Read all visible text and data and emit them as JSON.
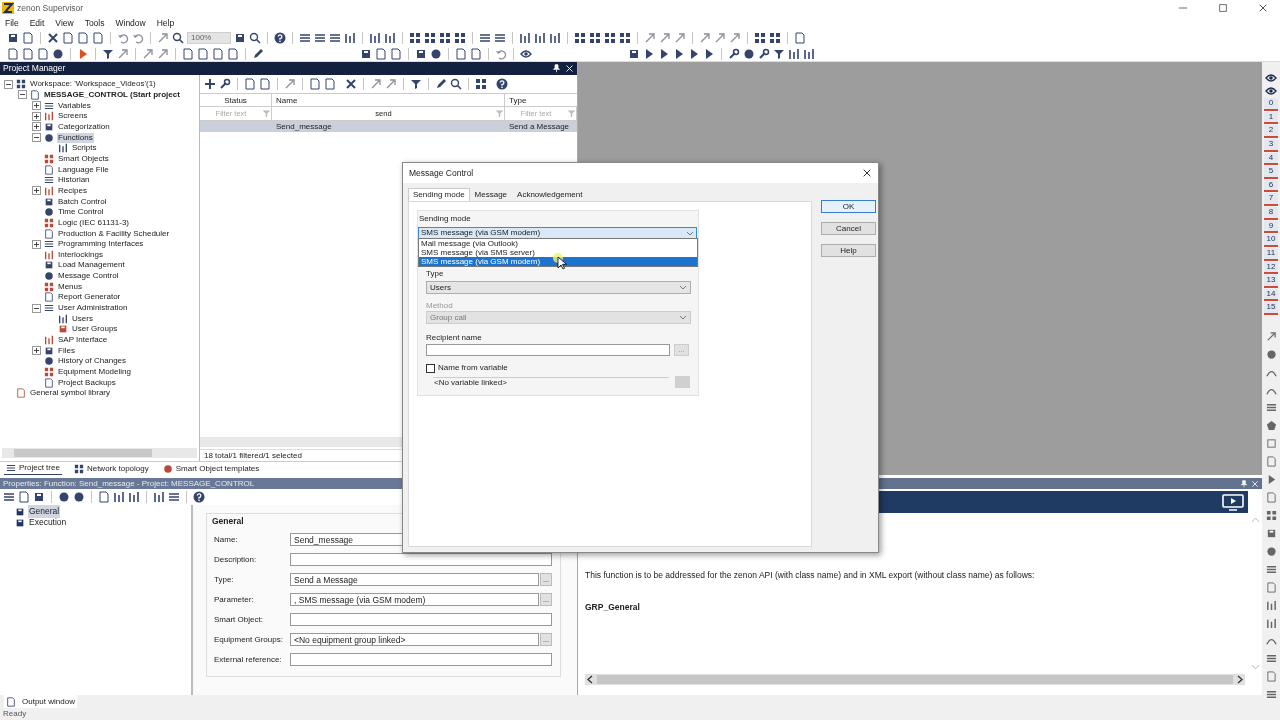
{
  "window": {
    "title": "zenon Supervisor"
  },
  "menu": [
    "File",
    "Edit",
    "View",
    "Tools",
    "Window",
    "Help"
  ],
  "toolbar": {
    "zoom": "100%"
  },
  "project_manager": {
    "title": "Project Manager",
    "tree": [
      {
        "label": "Workspace: 'Workspace_Videos'(1)",
        "expanded": true,
        "children": [
          {
            "label": "MESSAGE_CONTROL (Start project",
            "bold": true,
            "expanded": true,
            "children": [
              {
                "label": "Variables",
                "expanded": false
              },
              {
                "label": "Screens",
                "expanded": false
              },
              {
                "label": "Categorization",
                "expanded": false
              },
              {
                "label": "Functions",
                "expanded": true,
                "selected": true,
                "children": [
                  {
                    "label": "Scripts"
                  }
                ]
              },
              {
                "label": "Smart Objects"
              },
              {
                "label": "Language File"
              },
              {
                "label": "Historian"
              },
              {
                "label": "Recipes",
                "expanded": false
              },
              {
                "label": "Batch Control"
              },
              {
                "label": "Time Control"
              },
              {
                "label": "Logic (IEC 61131-3)"
              },
              {
                "label": "Production & Facility Scheduler"
              },
              {
                "label": "Programming Interfaces",
                "expanded": false
              },
              {
                "label": "Interlockings"
              },
              {
                "label": "Load Management"
              },
              {
                "label": "Message Control"
              },
              {
                "label": "Menus"
              },
              {
                "label": "Report Generator"
              },
              {
                "label": "User Administration",
                "expanded": true,
                "children": [
                  {
                    "label": "Users"
                  },
                  {
                    "label": "User Groups"
                  }
                ]
              },
              {
                "label": "SAP Interface"
              },
              {
                "label": "Files",
                "expanded": false
              },
              {
                "label": "History of Changes"
              },
              {
                "label": "Equipment Modeling"
              },
              {
                "label": "Project Backups"
              }
            ]
          }
        ]
      },
      {
        "label": "General symbol library"
      }
    ],
    "list": {
      "columns": [
        "Status",
        "Name",
        "Type"
      ],
      "filters": [
        {
          "placeholder": "Filter text"
        },
        {
          "value": "send"
        },
        {
          "placeholder": "Filter text"
        }
      ],
      "rows": [
        {
          "name": "Send_message",
          "type": "Send a Message",
          "selected": true
        }
      ],
      "summary": "18 total/1 filtered/1 selected"
    },
    "tabs": [
      {
        "label": "Project tree",
        "selected": true
      },
      {
        "label": "Network topology",
        "selected": false
      },
      {
        "label": "Smart Object templates",
        "selected": false
      }
    ]
  },
  "properties": {
    "title": "Properties: Function: Send_message - Project: MESSAGE_CONTROL",
    "tree": [
      {
        "label": "General",
        "selected": true
      },
      {
        "label": "Execution",
        "selected": false
      }
    ],
    "group": "General",
    "fields": [
      {
        "label": "Name:",
        "value": "Send_message"
      },
      {
        "label": "Description:"
      },
      {
        "label": "Type:",
        "value": "Send a Message",
        "button": "..."
      },
      {
        "label": "Parameter:",
        "value": ", SMS message (via GSM modem)",
        "button": "..."
      },
      {
        "label": "Smart Object:"
      },
      {
        "label": "Equipment Groups:",
        "value": "<No equipment group linked>",
        "button": "..."
      },
      {
        "label": "External reference:"
      }
    ]
  },
  "help": {
    "text": "This function is to be addressed for the zenon API (with class name) and in XML export (without class name) as follows:",
    "heading": "GRP_General"
  },
  "dialog": {
    "title": "Message Control",
    "tabs": [
      {
        "label": "Sending mode",
        "selected": true
      },
      {
        "label": "Message",
        "selected": false
      },
      {
        "label": "Acknowledgement",
        "selected": false
      }
    ],
    "sending_mode": {
      "label": "Sending mode",
      "value": "SMS message (via GSM modem)",
      "expanded": true,
      "options": [
        {
          "label": "Mail message (via Outlook)",
          "selected": false
        },
        {
          "label": "SMS message (via SMS server)",
          "selected": false
        },
        {
          "label": "SMS message (via GSM modem)",
          "selected": true
        }
      ]
    },
    "type": {
      "label": "Type",
      "value": "Users",
      "disabled": false
    },
    "method": {
      "label": "Method",
      "value": "Group call",
      "disabled": true
    },
    "recipient": {
      "label": "Recipient name",
      "button": "..."
    },
    "name_from_variable": {
      "label": "Name from variable",
      "checked": false
    },
    "variable": {
      "value": "<No variable linked>"
    },
    "buttons": [
      {
        "label": "OK",
        "default": true
      },
      {
        "label": "Cancel",
        "default": false
      },
      {
        "label": "Help",
        "default": false
      }
    ]
  },
  "output_tab": "Output window",
  "status": "Ready",
  "palette": {
    "numbers": [
      "0",
      "1",
      "2",
      "3",
      "4",
      "5",
      "6",
      "7",
      "8",
      "9",
      "10",
      "11",
      "12",
      "13",
      "14",
      "15"
    ]
  }
}
